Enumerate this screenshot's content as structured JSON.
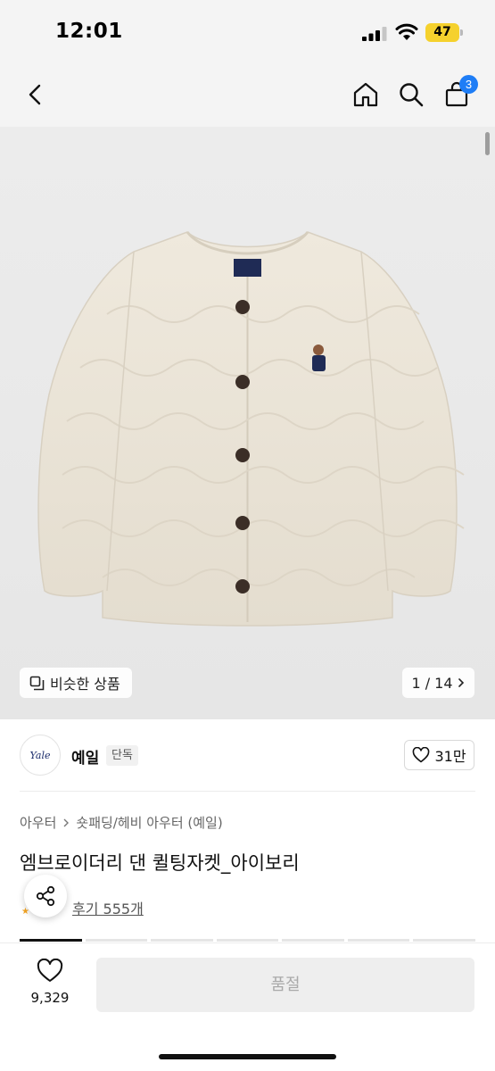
{
  "status_bar": {
    "time": "12:01",
    "battery": "47"
  },
  "nav": {
    "back_icon": "chevron-left-icon",
    "home_icon": "home-icon",
    "search_icon": "search-icon",
    "cart_icon": "shopping-bag-icon",
    "cart_count": "3",
    "badge_color": "#1e7df6"
  },
  "gallery": {
    "similar_label": "비슷한 상품",
    "counter": "1 / 14"
  },
  "brand": {
    "logo_text": "Yale",
    "name": "예일",
    "tag": "단독",
    "likes": "31만"
  },
  "breadcrumb": {
    "items": [
      "아우터",
      "숏패딩/헤비 아우터 (예일)"
    ]
  },
  "product": {
    "title": "엠브로이더리 댄 퀼팅자켓_아이보리",
    "review_link": "후기 555개",
    "jacket_color": "#ece6da"
  },
  "bottom": {
    "wish_count": "9,329",
    "soldout_label": "품절",
    "soldout_bg": "#eeeeee"
  }
}
